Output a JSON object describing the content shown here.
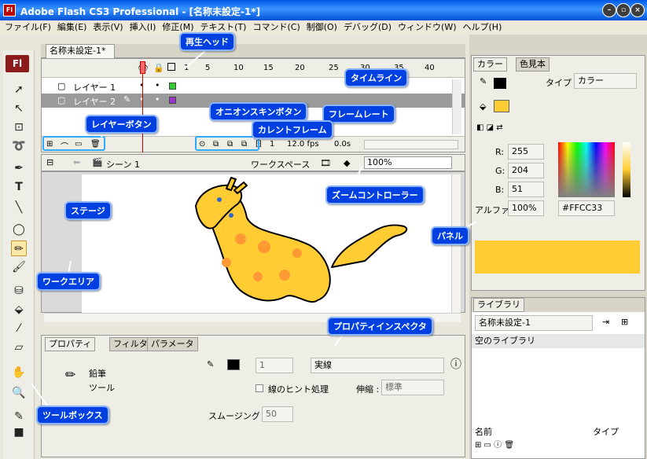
{
  "window": {
    "title": "Adobe Flash CS3 Professional - [名称未設定-1*]",
    "app_icon": "Fl",
    "controls": [
      "minimize-icon",
      "restore-icon",
      "close-icon"
    ]
  },
  "menu": [
    "ファイル(F)",
    "編集(E)",
    "表示(V)",
    "挿入(I)",
    "修正(M)",
    "テキスト(T)",
    "コマンド(C)",
    "制御(O)",
    "デバッグ(D)",
    "ウィンドウ(W)",
    "ヘルプ(H)"
  ],
  "document": {
    "tab": "名称未設定-1*"
  },
  "timeline": {
    "frame_numbers": [
      "1",
      "5",
      "10",
      "15",
      "20",
      "25",
      "30",
      "35",
      "40"
    ],
    "layers": [
      {
        "name": "レイヤー 1",
        "color": "#33cc33"
      },
      {
        "name": "レイヤー 2",
        "color": "#9933cc"
      }
    ],
    "current_frame": "1",
    "frame_rate": "12.0 fps",
    "time": "0.0s"
  },
  "scene": {
    "name": "シーン 1",
    "workspace": "ワークスペース",
    "zoom": "100%"
  },
  "properties": {
    "tabs": [
      "プロパティ",
      "フィルタ",
      "パラメータ"
    ],
    "tool_name": "鉛筆",
    "tool_label": "ツール",
    "stroke_size": "1",
    "stroke_style": "実線",
    "hinting": "線のヒント処理",
    "scale_label": "伸縮 :",
    "scale_value": "標準",
    "smoothing_label": "スムージング :",
    "smoothing_value": "50"
  },
  "color_panel": {
    "tabs": [
      "カラー",
      "色見本"
    ],
    "type_label": "タイプ :",
    "type_value": "カラー",
    "r_label": "R:",
    "r": "255",
    "g_label": "G:",
    "g": "204",
    "b_label": "B:",
    "b": "51",
    "alpha_label": "アルファ:",
    "alpha": "100%",
    "hex": "#FFCC33",
    "fill_color": "#ffcc33"
  },
  "library": {
    "tab": "ライブラリ",
    "doc": "名称未設定-1",
    "empty": "空のライブラリ",
    "col_name": "名前",
    "col_type": "タイプ"
  },
  "callouts": {
    "playhead": "再生ヘッド",
    "timeline": "タイムライン",
    "layer_buttons": "レイヤーボタン",
    "onion": "オニオンスキンボタン",
    "frame_rate": "フレームレート",
    "current_frame": "カレントフレーム",
    "zoom": "ズームコントローラー",
    "stage": "ステージ",
    "work_area": "ワークエリア",
    "panel": "パネル",
    "property_inspector": "プロパティインスペクタ",
    "toolbox": "ツールボックス"
  }
}
